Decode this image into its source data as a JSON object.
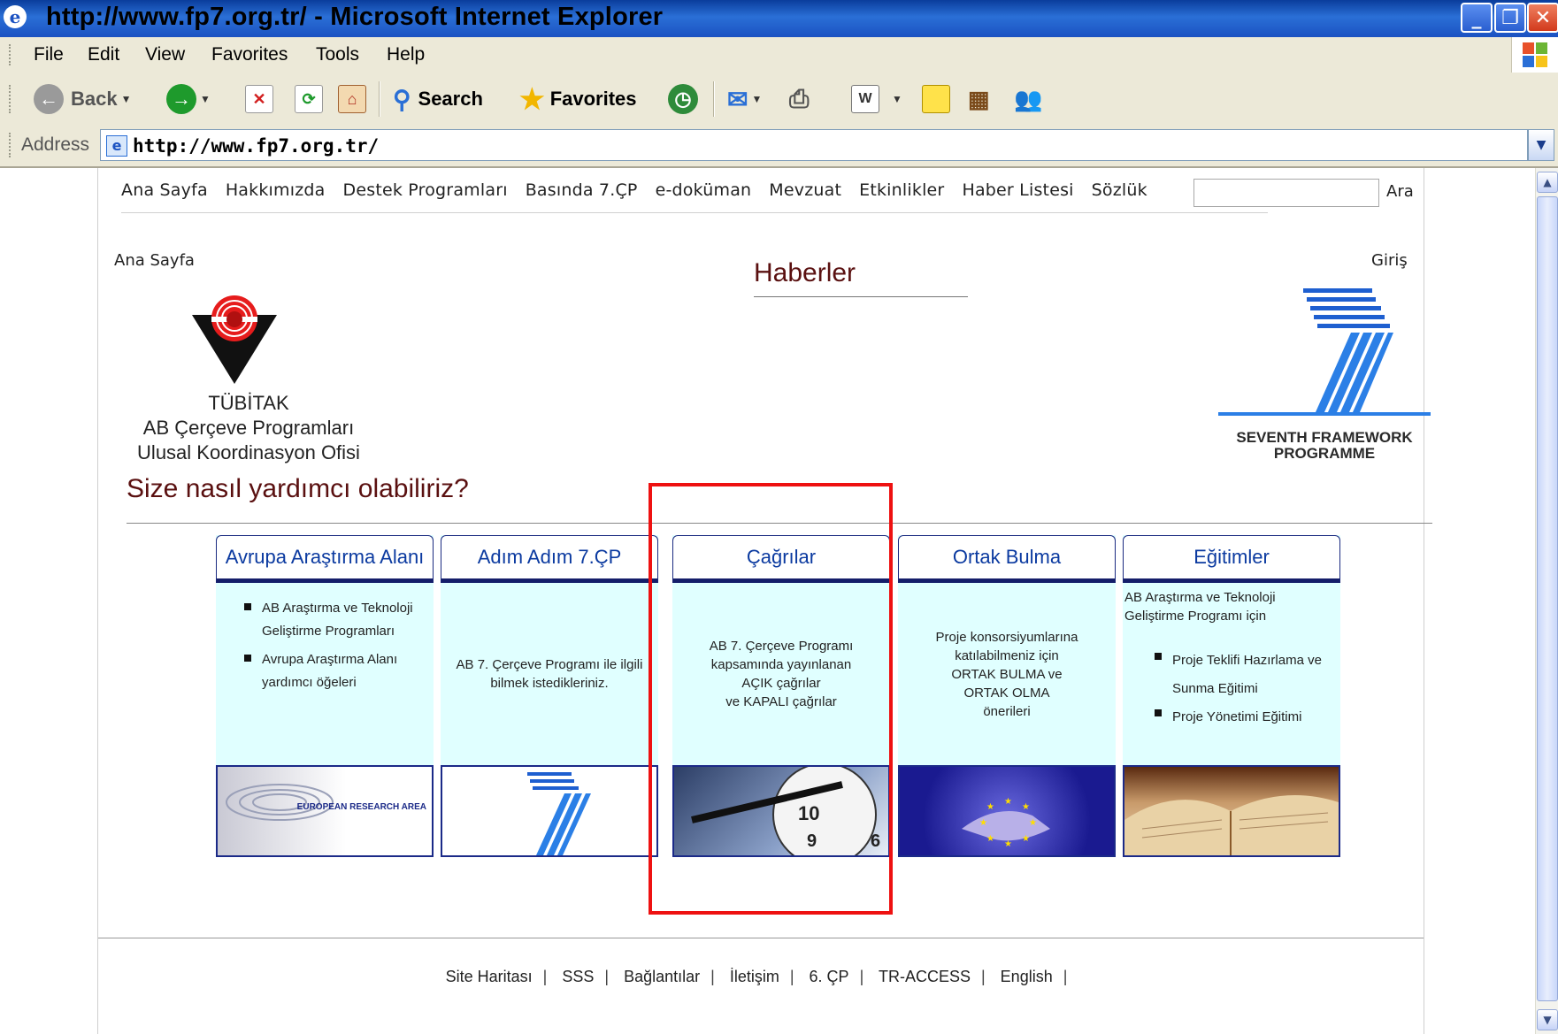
{
  "window": {
    "title": "http://www.fp7.org.tr/ - Microsoft Internet Explorer"
  },
  "menu": [
    "File",
    "Edit",
    "View",
    "Favorites",
    "Tools",
    "Help"
  ],
  "toolbar": {
    "back": "Back",
    "search": "Search",
    "favorites": "Favorites"
  },
  "address": {
    "label": "Address",
    "url": "http://www.fp7.org.tr/"
  },
  "nav": {
    "items": [
      "Ana Sayfa",
      "Hakkımızda",
      "Destek Programları",
      "Basında 7.ÇP",
      "e-doküman",
      "Mevzuat",
      "Etkinlikler",
      "Haber Listesi",
      "Sözlük"
    ],
    "search_label": "Ara"
  },
  "breadcrumb": "Ana Sayfa",
  "login": "Giriş",
  "org": {
    "line1": "TÜBİTAK",
    "line2": "AB Çerçeve Programları",
    "line3": "Ulusal Koordinasyon Ofisi"
  },
  "news_title": "Haberler",
  "fp7": {
    "line1": "SEVENTH FRAMEWORK",
    "line2": "PROGRAMME"
  },
  "help_title": "Size nasıl yardımcı olabiliriz?",
  "boxes": [
    {
      "title": "Avrupa Araştırma Alanı",
      "bullets": [
        "AB Araştırma ve Teknoloji Geliştirme Programları",
        "Avrupa Araştırma Alanı yardımcı öğeleri"
      ],
      "image_text": "EUROPEAN RESEARCH AREA"
    },
    {
      "title": "Adım Adım 7.ÇP",
      "text": "AB 7. Çerçeve Programı ile ilgili bilmek istedikleriniz."
    },
    {
      "title": "Çağrılar",
      "lines": [
        "AB 7. Çerçeve Programı",
        "kapsamında yayınlanan",
        "AÇIK çağrılar",
        "ve KAPALI çağrılar"
      ]
    },
    {
      "title": "Ortak Bulma",
      "lines": [
        "Proje konsorsiyumlarına",
        "katılabilmeniz için",
        "ORTAK BULMA ve",
        "ORTAK OLMA",
        "önerileri"
      ]
    },
    {
      "title": "Eğitimler",
      "intro": "AB Araştırma ve Teknoloji Geliştirme Programı için",
      "bullets": [
        "Proje Teklifi Hazırlama ve Sunma Eğitimi",
        "Proje Yönetimi Eğitimi"
      ]
    }
  ],
  "footer": [
    "Site Haritası",
    "SSS",
    "Bağlantılar",
    "İletişim",
    "6. ÇP",
    "TR-ACCESS",
    "English"
  ],
  "colors": {
    "accent_dark_red": "#5a1010",
    "link_blue": "#0b3aa0",
    "box_bg": "#e0ffff",
    "highlight": "#ee1111"
  }
}
